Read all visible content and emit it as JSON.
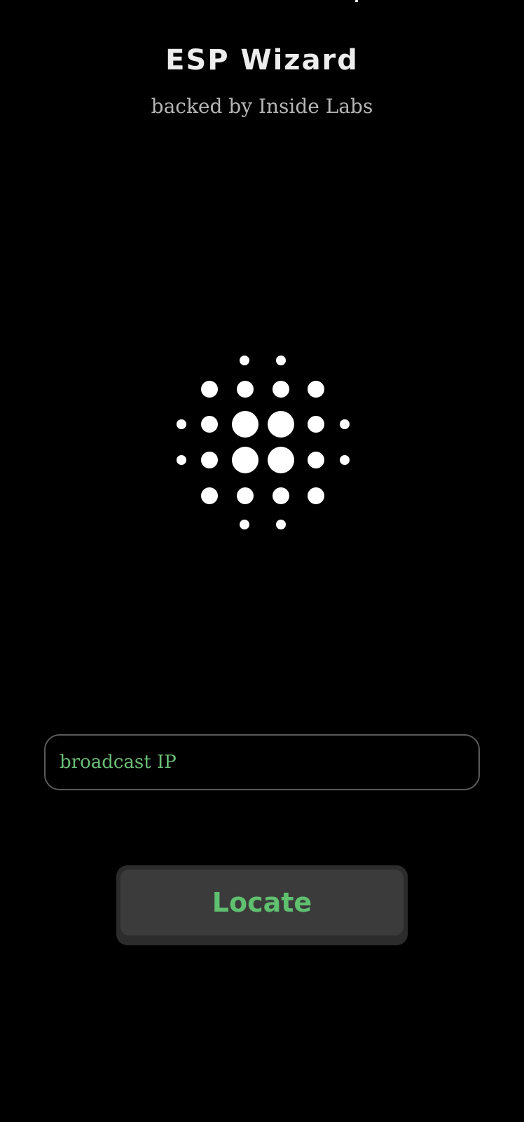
{
  "header": {
    "title": "ESP Wizard",
    "subtitle": "backed by Inside Labs"
  },
  "logo": {
    "icon": "dot-sphere-icon",
    "color": "#ffffff"
  },
  "form": {
    "ip_placeholder": "broadcast IP",
    "ip_value": "",
    "locate_label": "Locate"
  },
  "colors": {
    "background": "#000000",
    "accent": "#5fc06f",
    "field_border": "#5a5a5a",
    "button_face": "#3b3b3b"
  }
}
